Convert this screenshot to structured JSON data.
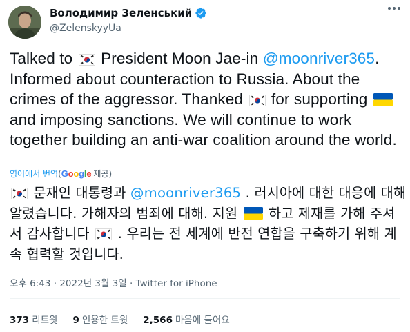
{
  "header": {
    "display_name": "Володимир Зеленський",
    "handle": "@ZelenskyyUa"
  },
  "tweet": {
    "p1": "Talked to",
    "p2": "President Moon Jae-in",
    "mention": "@moonriver365",
    "p3": ". Informed about counteraction to Russia. About the crimes of the aggressor. Thanked",
    "p4": "for supporting",
    "p5": "and imposing sanctions. We will continue to work together building an anti-war coalition around the world."
  },
  "translate": {
    "label": "영어에서 번역",
    "open_paren": "(",
    "google": "Google",
    "provided": "제공)"
  },
  "translation": {
    "t1": "문재인 대통령과",
    "mention": "@moonriver365",
    "t2": ". 러시아에 대한 대응에 대해 알렸습니다. 가해자의 범죄에 대해. 지원",
    "t3": "하고 제재를 가해 주셔서 감사합니다",
    "t4": ". 우리는 전 세계에 반전 연합을 구축하기 위해 계속 협력할 것입니다."
  },
  "meta": {
    "time": "오후 6:43",
    "sep1": "·",
    "date": "2022년 3월 3일",
    "sep2": "·",
    "source": "Twitter for iPhone"
  },
  "stats": {
    "retweets": "373",
    "retweets_label": "리트윗",
    "quotes": "9",
    "quotes_label": "인용한 트윗",
    "likes": "2,566",
    "likes_label": "마음에 들어요"
  },
  "colors": {
    "accent": "#1d9bf0",
    "secondary_text": "#536471",
    "divider": "#eff3f4"
  },
  "icons": [
    "verified-badge-icon",
    "more-options-icon",
    "south-korea-flag-icon",
    "ukraine-flag-icon"
  ]
}
